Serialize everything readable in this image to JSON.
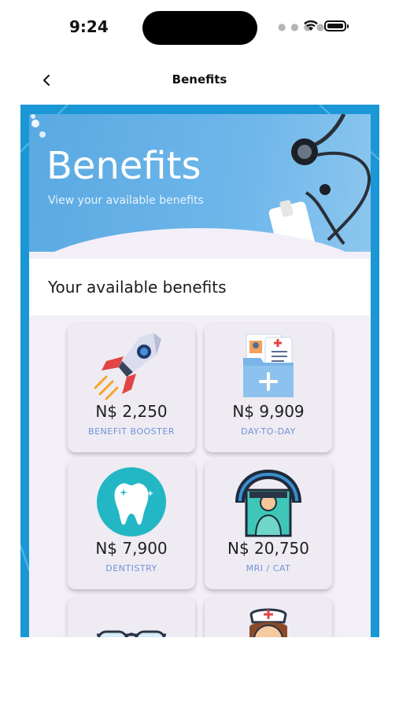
{
  "status_bar": {
    "time": "9:24"
  },
  "nav": {
    "back_icon": "chevron-left-icon",
    "title": "Benefits"
  },
  "banner": {
    "title": "Benefits",
    "subtitle": "View your available benefits"
  },
  "section": {
    "title": "Your available benefits"
  },
  "benefits": [
    {
      "icon": "rocket-icon",
      "amount": "N$ 2,250",
      "label": "BENEFIT BOOSTER"
    },
    {
      "icon": "medical-folder-icon",
      "amount": "N$ 9,909",
      "label": "DAY-TO-DAY"
    },
    {
      "icon": "tooth-icon",
      "amount": "N$ 7,900",
      "label": "DENTISTRY"
    },
    {
      "icon": "mri-scanner-icon",
      "amount": "N$ 20,750",
      "label": "MRI / CAT"
    },
    {
      "icon": "glasses-icon",
      "amount": "",
      "label": ""
    },
    {
      "icon": "nurse-icon",
      "amount": "",
      "label": ""
    }
  ],
  "colors": {
    "frame": "#1a97d4",
    "banner": "#6db6ea",
    "label": "#6f93d8"
  }
}
